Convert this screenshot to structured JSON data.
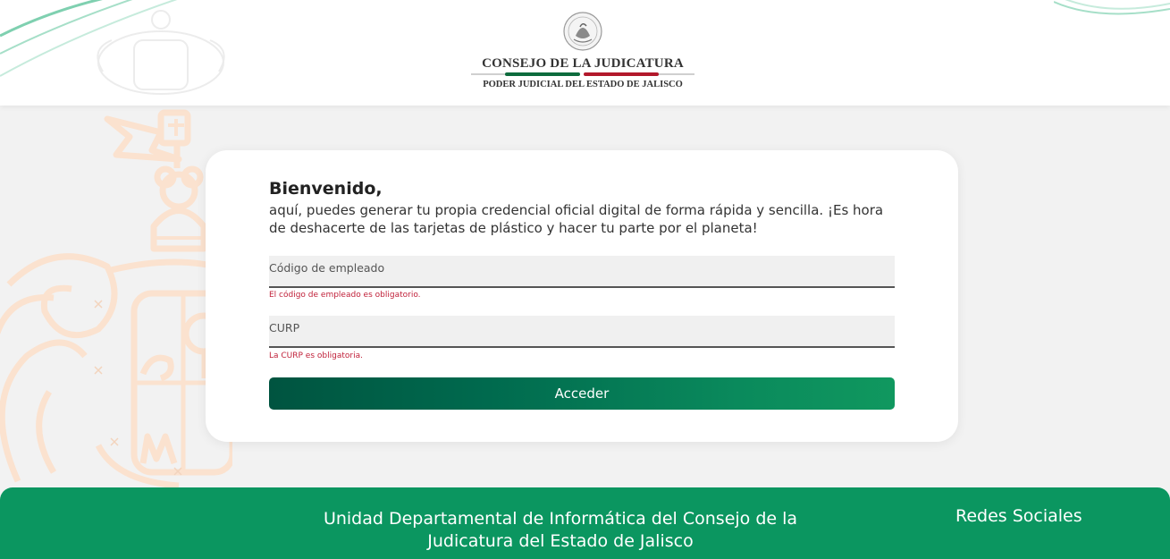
{
  "header": {
    "logo_title": "CONSEJO DE LA JUDICATURA",
    "logo_subtitle": "PODER JUDICIAL DEL ESTADO DE JALISCO"
  },
  "login": {
    "welcome": "Bienvenido,",
    "intro": "aquí, puedes generar tu propia credencial oficial digital de forma rápida y sencilla. ¡Es hora de deshacerte de las tarjetas de plástico y hacer tu parte por el planeta!",
    "employee_code_placeholder": "Código de empleado",
    "employee_code_error": "El código de empleado es obligatorio.",
    "curp_placeholder": "CURP",
    "curp_error": "La CURP es obligatoria.",
    "submit_label": "Acceder"
  },
  "footer": {
    "org_name": "Unidad Departamental de Informática del Consejo de la Judicatura del Estado de Jalisco",
    "social_title": "Redes Sociales"
  },
  "colors": {
    "brand_green": "#0b9660",
    "dark_green": "#005440",
    "error_red": "#c0213a",
    "coat_watermark": "#fbe2cf"
  },
  "icons": {
    "header_seal": "mexican-national-seal-icon",
    "watermark": "jalisco-coat-of-arms-icon"
  }
}
